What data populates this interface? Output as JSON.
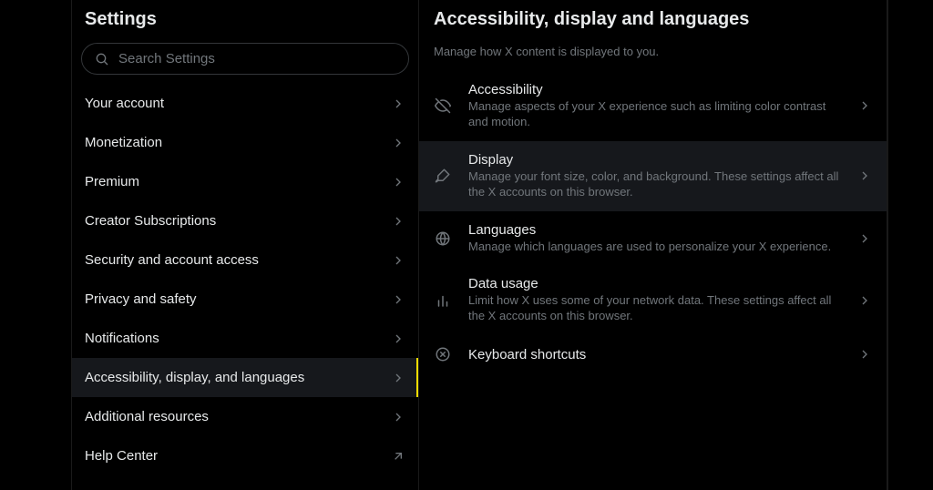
{
  "left": {
    "title": "Settings",
    "search_placeholder": "Search Settings",
    "items": [
      {
        "label": "Your account",
        "icon": "chevron-right",
        "active": false
      },
      {
        "label": "Monetization",
        "icon": "chevron-right",
        "active": false
      },
      {
        "label": "Premium",
        "icon": "chevron-right",
        "active": false
      },
      {
        "label": "Creator Subscriptions",
        "icon": "chevron-right",
        "active": false
      },
      {
        "label": "Security and account access",
        "icon": "chevron-right",
        "active": false
      },
      {
        "label": "Privacy and safety",
        "icon": "chevron-right",
        "active": false
      },
      {
        "label": "Notifications",
        "icon": "chevron-right",
        "active": false
      },
      {
        "label": "Accessibility, display, and languages",
        "icon": "chevron-right",
        "active": true
      },
      {
        "label": "Additional resources",
        "icon": "chevron-right",
        "active": false
      },
      {
        "label": "Help Center",
        "icon": "arrow-up-right",
        "active": false
      }
    ]
  },
  "right": {
    "title": "Accessibility, display and languages",
    "subtitle": "Manage how X content is displayed to you.",
    "items": [
      {
        "icon": "eye-off",
        "title": "Accessibility",
        "desc": "Manage aspects of your X experience such as limiting color contrast and motion.",
        "hover": false
      },
      {
        "icon": "brush",
        "title": "Display",
        "desc": "Manage your font size, color, and background. These settings affect all the X accounts on this browser.",
        "hover": true
      },
      {
        "icon": "globe",
        "title": "Languages",
        "desc": "Manage which languages are used to personalize your X experience.",
        "hover": false
      },
      {
        "icon": "bars",
        "title": "Data usage",
        "desc": "Limit how X uses some of your network data. These settings affect all the X accounts on this browser.",
        "hover": false
      },
      {
        "icon": "circle-x",
        "title": "Keyboard shortcuts",
        "desc": "",
        "hover": false
      }
    ]
  }
}
